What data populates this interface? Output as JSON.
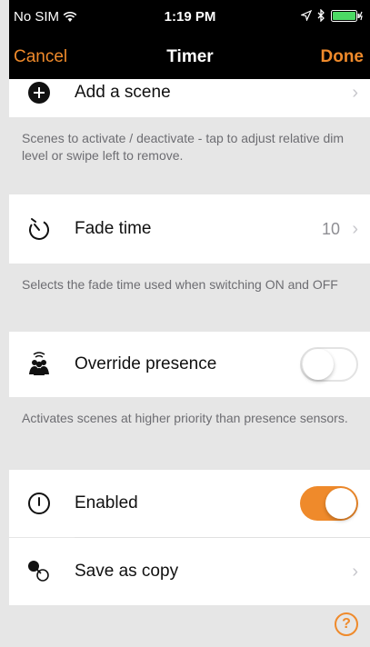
{
  "status_bar": {
    "carrier": "No SIM",
    "time": "1:19 PM"
  },
  "nav": {
    "cancel": "Cancel",
    "title": "Timer",
    "done": "Done"
  },
  "add_scene": {
    "label": "Add a scene",
    "description": "Scenes to activate / deactivate - tap to adjust relative dim level or swipe left to remove."
  },
  "fade_time": {
    "label": "Fade time",
    "value": "10",
    "description": "Selects the fade time used when switching ON and OFF"
  },
  "override_presence": {
    "label": "Override presence",
    "enabled": false,
    "description": "Activates scenes at higher priority than presence sensors."
  },
  "enabled": {
    "label": "Enabled",
    "enabled": true
  },
  "save_as_copy": {
    "label": "Save as copy"
  },
  "help": {
    "symbol": "?"
  },
  "colors": {
    "accent": "#ef8a2b",
    "background": "#e6e6e6",
    "secondary_text": "#6d6d72"
  }
}
